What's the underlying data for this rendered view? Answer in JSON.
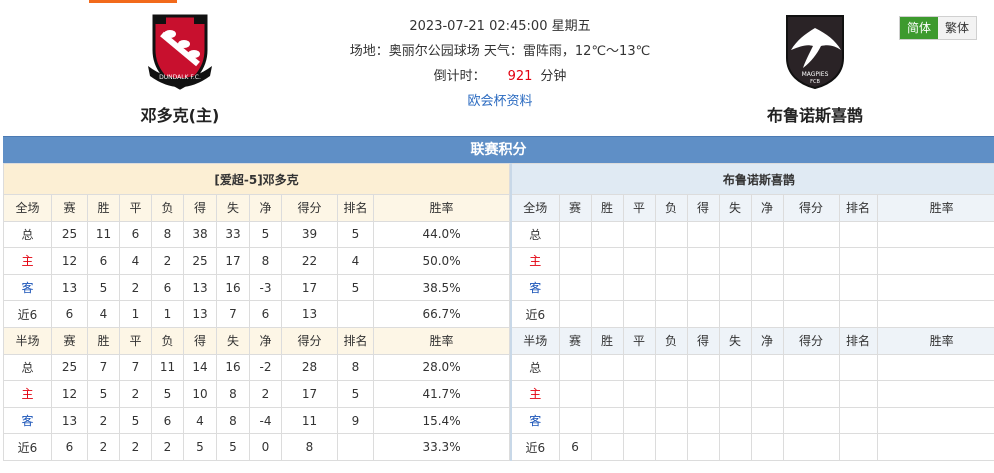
{
  "header": {
    "home_team": {
      "name": "邓多克(主)",
      "logo_text": "DUNDALK F.C."
    },
    "away_team": {
      "name": "布鲁诺斯喜鹊",
      "logo_text": "MAGPIES",
      "logo_sub": "FCB"
    },
    "datetime": "2023-07-21 02:45:00 星期五",
    "venue_weather": "场地：奥丽尔公园球场 天气：雷阵雨，12℃～13℃",
    "countdown_label": "倒计时：",
    "countdown_value": "921",
    "countdown_unit": "分钟",
    "cup_link": "欧会杯资料"
  },
  "lang": {
    "simplified": "简体",
    "traditional": "繁体"
  },
  "standings": {
    "title": "联赛积分",
    "home_team_label": "[爱超-5]邓多克",
    "away_team_label": "布鲁诺斯喜鹊",
    "full_header": [
      "全场",
      "赛",
      "胜",
      "平",
      "负",
      "得",
      "失",
      "净",
      "得分",
      "排名",
      "胜率"
    ],
    "half_header": [
      "半场",
      "赛",
      "胜",
      "平",
      "负",
      "得",
      "失",
      "净",
      "得分",
      "排名",
      "胜率"
    ],
    "home_full": [
      [
        "总",
        "25",
        "11",
        "6",
        "8",
        "38",
        "33",
        "5",
        "39",
        "5",
        "44.0%"
      ],
      [
        "主",
        "12",
        "6",
        "4",
        "2",
        "25",
        "17",
        "8",
        "22",
        "4",
        "50.0%"
      ],
      [
        "客",
        "13",
        "5",
        "2",
        "6",
        "13",
        "16",
        "-3",
        "17",
        "5",
        "38.5%"
      ],
      [
        "近6",
        "6",
        "4",
        "1",
        "1",
        "13",
        "7",
        "6",
        "13",
        "",
        "66.7%"
      ]
    ],
    "home_half": [
      [
        "总",
        "25",
        "7",
        "7",
        "11",
        "14",
        "16",
        "-2",
        "28",
        "8",
        "28.0%"
      ],
      [
        "主",
        "12",
        "5",
        "2",
        "5",
        "10",
        "8",
        "2",
        "17",
        "5",
        "41.7%"
      ],
      [
        "客",
        "13",
        "2",
        "5",
        "6",
        "4",
        "8",
        "-4",
        "11",
        "9",
        "15.4%"
      ],
      [
        "近6",
        "6",
        "2",
        "2",
        "2",
        "5",
        "5",
        "0",
        "8",
        "",
        "33.3%"
      ]
    ],
    "away_full": [
      [
        "总",
        "",
        "",
        "",
        "",
        "",
        "",
        "",
        "",
        "",
        ""
      ],
      [
        "主",
        "",
        "",
        "",
        "",
        "",
        "",
        "",
        "",
        "",
        ""
      ],
      [
        "客",
        "",
        "",
        "",
        "",
        "",
        "",
        "",
        "",
        "",
        ""
      ],
      [
        "近6",
        "",
        "",
        "",
        "",
        "",
        "",
        "",
        "",
        "",
        ""
      ]
    ],
    "away_half": [
      [
        "总",
        "",
        "",
        "",
        "",
        "",
        "",
        "",
        "",
        "",
        ""
      ],
      [
        "主",
        "",
        "",
        "",
        "",
        "",
        "",
        "",
        "",
        "",
        ""
      ],
      [
        "客",
        "",
        "",
        "",
        "",
        "",
        "",
        "",
        "",
        "",
        ""
      ],
      [
        "近6",
        "6",
        "",
        "",
        "",
        "",
        "",
        "",
        "",
        "",
        ""
      ]
    ]
  },
  "colors": {
    "accent_green": "#3d9a2e",
    "header_blue": "#5f8fc6",
    "home_red": "#e3000f",
    "away_blue": "#1a54b8"
  }
}
